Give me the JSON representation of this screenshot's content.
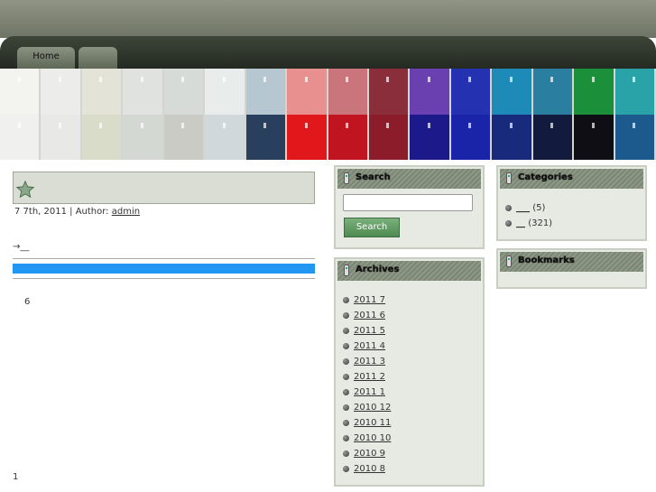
{
  "nav": {
    "tabs": [
      {
        "label": "Home"
      },
      {
        "label": ""
      }
    ]
  },
  "banner": {
    "top_colors": [
      "#f3f3f0",
      "#ececea",
      "#e3e4d7",
      "#dfe2df",
      "#d6dbd8",
      "#e8eceb",
      "#b7c7d2",
      "#e88f90",
      "#c9757b",
      "#8a2e3c",
      "#6a3fb0",
      "#2431b0",
      "#1d8ab8",
      "#2a7ea0",
      "#1c8f3b",
      "#2aa3a8"
    ],
    "bottom_colors": [
      "#f0f0ee",
      "#e8e9e6",
      "#d9dcc9",
      "#d4d8d2",
      "#c9cbc4",
      "#d0d8db",
      "#28405e",
      "#e0181c",
      "#c01520",
      "#8c1c2a",
      "#1c1a8a",
      "#1a24a8",
      "#182a7c",
      "#121a3e",
      "#0e0e14",
      "#1c5a8e"
    ]
  },
  "post": {
    "date": "7  7th, 2011 | Author:",
    "author": "admin",
    "arrow_link": "→__",
    "count": "6",
    "page_number": "1"
  },
  "search": {
    "title": "Search",
    "button_label": "Search",
    "placeholder": ""
  },
  "archives": {
    "title": "Archives",
    "items": [
      "2011 7",
      "2011 6",
      "2011 5",
      "2011 4",
      "2011 3",
      "2011 2",
      "2011 1",
      "2010 12",
      "2010 11",
      "2010 10",
      "2010 9",
      "2010 8"
    ]
  },
  "categories": {
    "title": "Categories",
    "items": [
      {
        "label": "___",
        "count": "(5)"
      },
      {
        "label": "__",
        "count": "(321)"
      }
    ]
  },
  "bookmarks": {
    "title": "Bookmarks"
  },
  "colors": {
    "accent_blue": "#2196f3",
    "widget_bg": "#e7eae3",
    "button_green": "#4e8b52"
  }
}
